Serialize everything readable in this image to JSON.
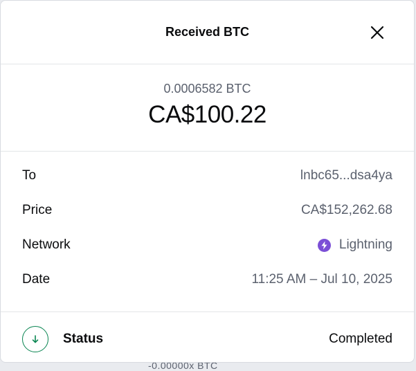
{
  "backdrop": {
    "partial_text": "-0.00000x BTC"
  },
  "modal": {
    "title": "Received BTC",
    "close_icon": "close-icon"
  },
  "amount": {
    "crypto": "0.0006582 BTC",
    "fiat": "CA$100.22"
  },
  "details": {
    "rows": [
      {
        "label": "To",
        "value": "lnbc65...dsa4ya"
      },
      {
        "label": "Price",
        "value": "CA$152,262.68"
      },
      {
        "label": "Network",
        "value": "Lightning",
        "icon": "lightning-bolt-icon"
      },
      {
        "label": "Date",
        "value": "11:25 AM – Jul 10, 2025"
      }
    ]
  },
  "status": {
    "icon": "arrow-down-icon",
    "label": "Status",
    "value": "Completed",
    "color": "#098551"
  },
  "colors": {
    "primary_text": "#0a0b0d",
    "secondary_text": "#5b616e",
    "lightning_accent": "#7b4fd6",
    "success": "#098551",
    "divider": "#e3e5e8"
  }
}
